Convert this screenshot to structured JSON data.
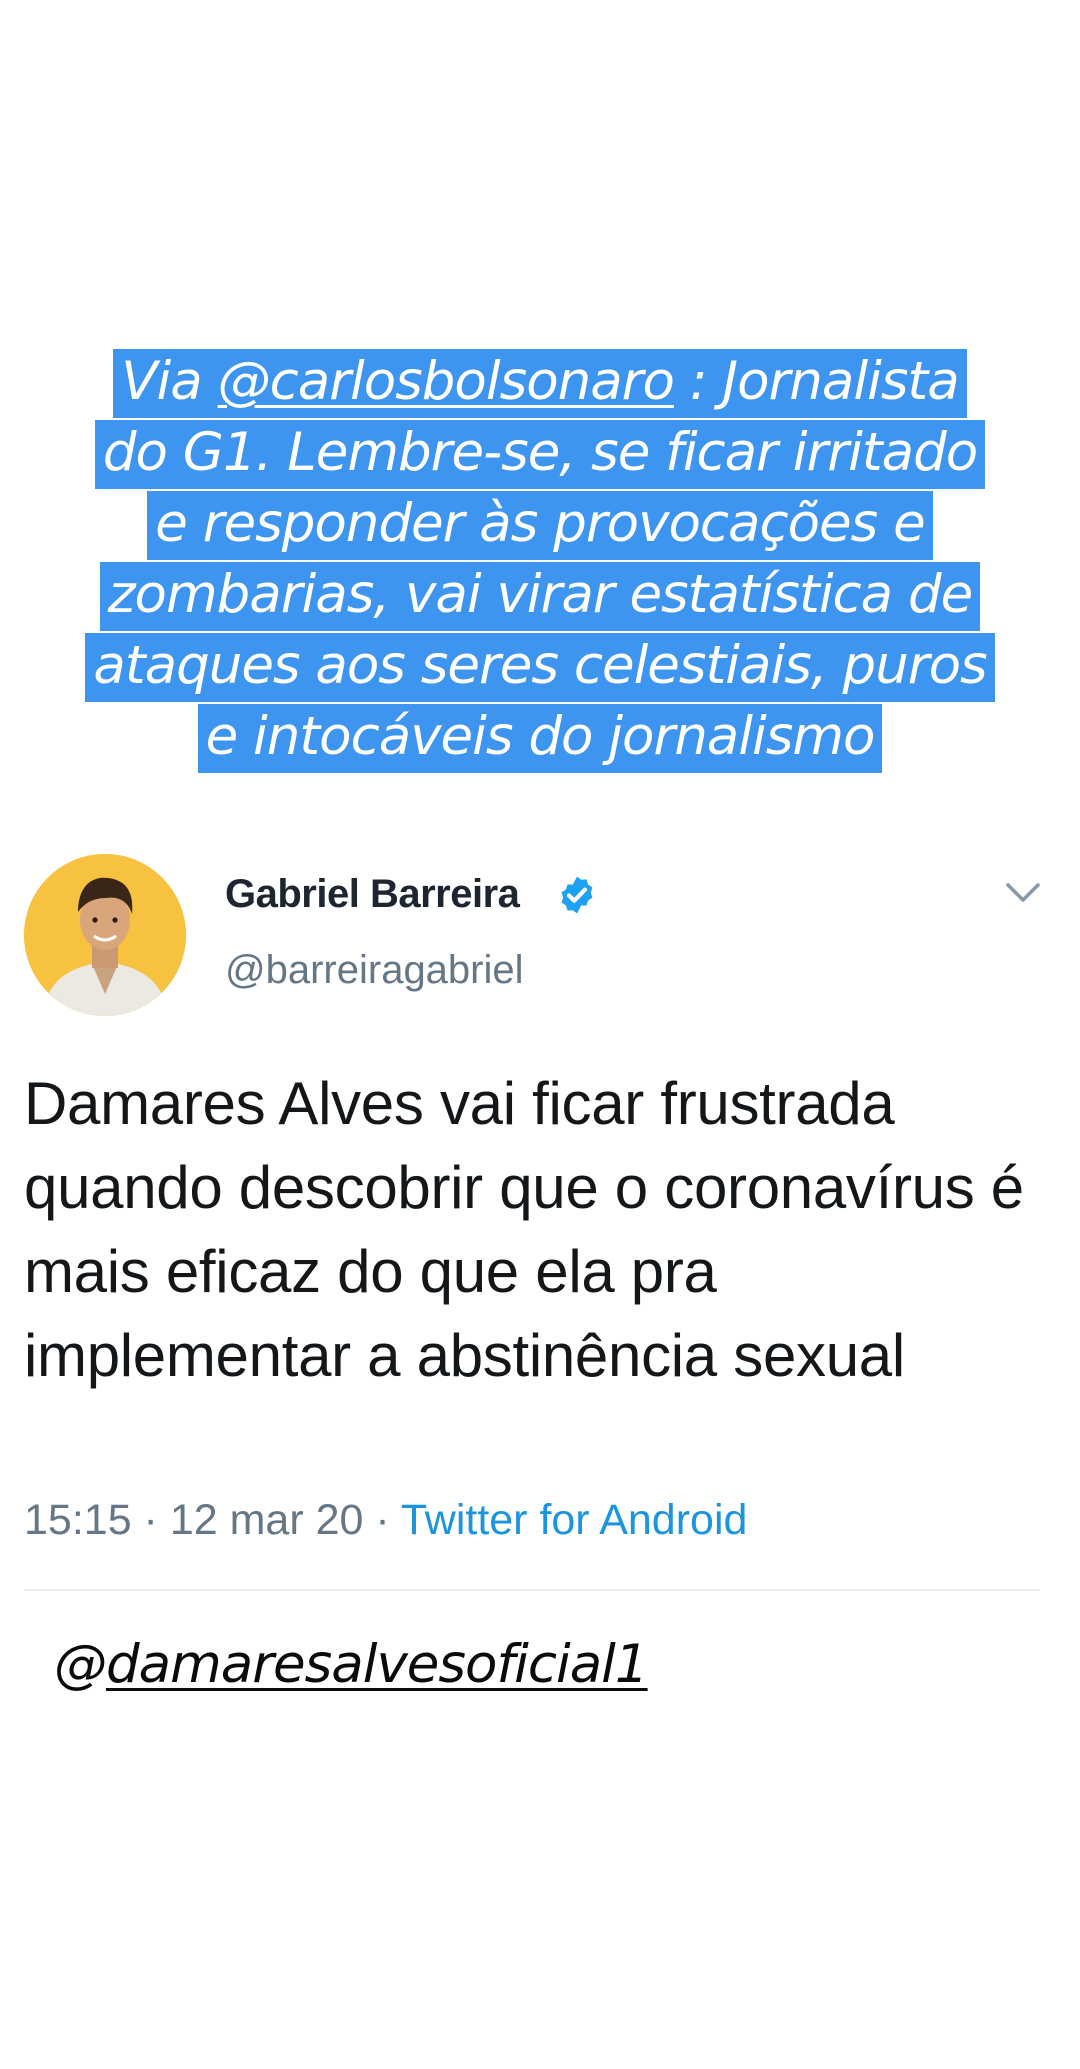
{
  "caption": {
    "prefix": "Via ",
    "mention": "@carlosbolsonaro",
    "line1_rest": " : Jornalista",
    "line2": "do G1. Lembre-se, se ficar irritado",
    "line3": "e responder às provocações e",
    "line4": "zombarias, vai virar estatística de",
    "line5": "ataques aos seres celestiais, puros",
    "line6": "e intocáveis do jornalismo",
    "highlight_color": "#3d95f0"
  },
  "tweet": {
    "author_name": "Gabriel Barreira",
    "author_handle": "@barreiragabriel",
    "verified": true,
    "verified_icon": "verified-badge-icon",
    "menu_icon": "chevron-down-icon",
    "text": "Damares Alves vai ficar frustrada quando descobrir que o coronavírus é mais eficaz do que ela pra implementar a abstinência sexual",
    "time": "15:15",
    "separator": " · ",
    "date": "12 mar 20",
    "source": "Twitter for Android",
    "source_color": "#1b95e0"
  },
  "footer": {
    "at": "@",
    "handle": "damaresalvesoficial1"
  }
}
